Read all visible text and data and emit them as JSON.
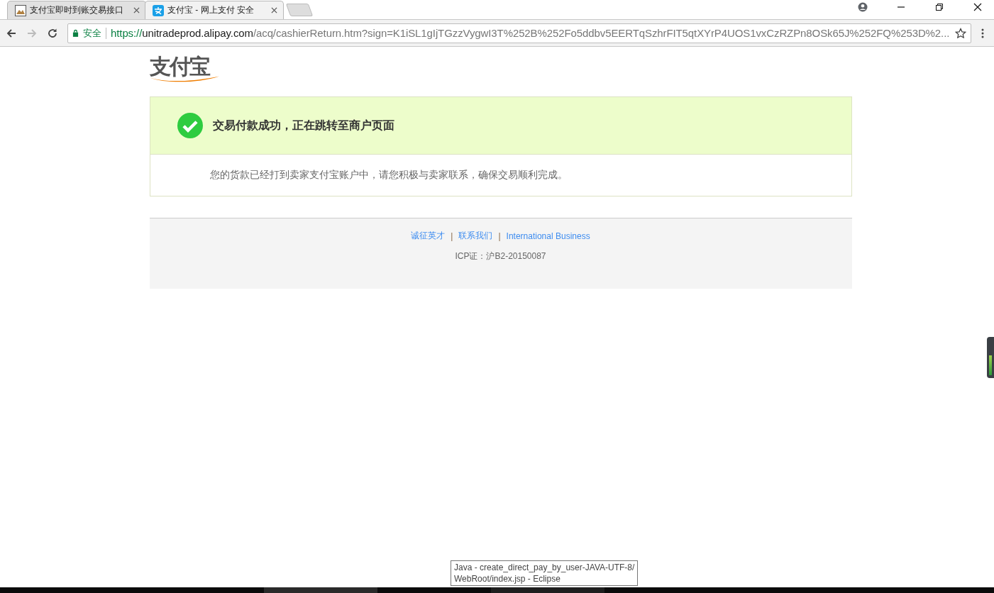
{
  "browser": {
    "tabs": [
      {
        "title": "支付宝即时到账交易接口",
        "selected": false
      },
      {
        "title": "支付宝 - 网上支付 安全",
        "selected": true
      }
    ],
    "security_label": "安全",
    "url": {
      "scheme": "https://",
      "host": "unitradeprod.alipay.com",
      "path": "/acq/cashierReturn.htm?sign=K1iSL1gIjTGzzVygwI3T%252B%252Fo5ddbv5EERTqSzhrFIT5qtXYrP4UOS1vxCzRZPn8OSk65J%252FQ%253D%2..."
    }
  },
  "page": {
    "logo": "支付宝",
    "result": {
      "kind": "success",
      "title": "交易付款成功，正在跳转至商户页面",
      "message": "您的货款已经打到卖家支付宝账户中，请您积极与卖家联系，确保交易顺利完成。"
    },
    "footer": {
      "links": [
        "诚征英才",
        "联系我们",
        "International Business"
      ],
      "separator": "|",
      "icp": "ICP证：沪B2-20150087"
    }
  },
  "tooltip": {
    "lines": [
      "Java - create_direct_pay_by_user-JAVA-UTF-8/",
      "WebRoot/index.jsp - Eclipse"
    ]
  }
}
